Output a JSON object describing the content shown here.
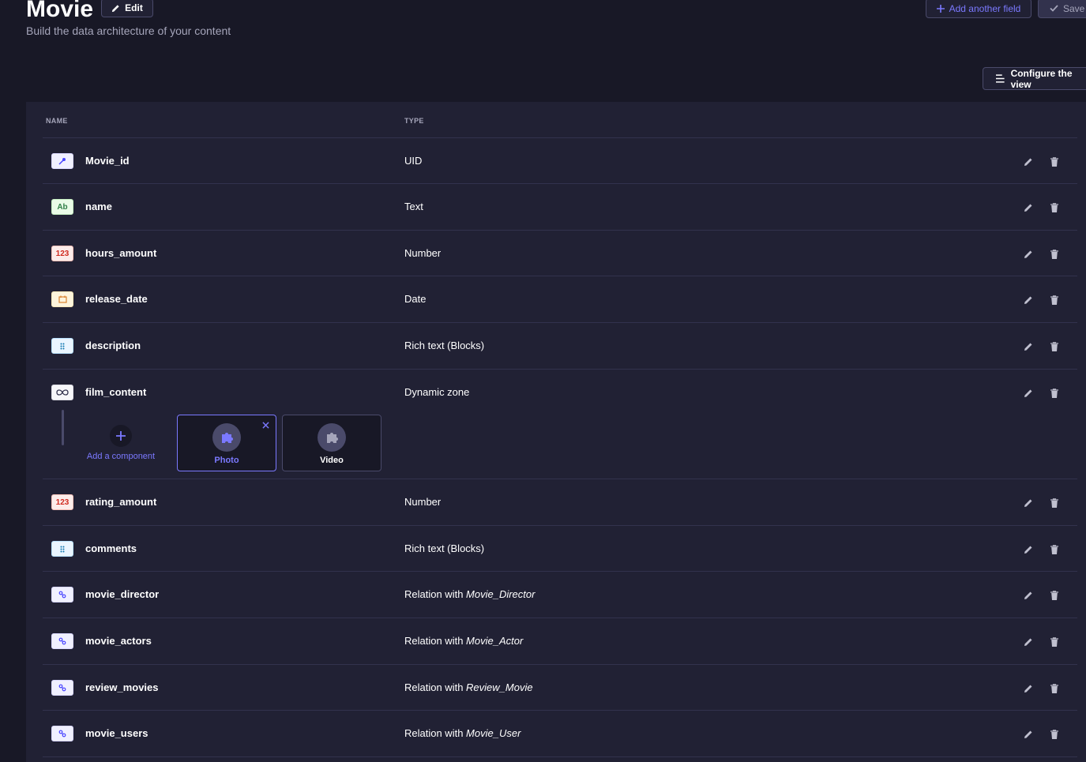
{
  "header": {
    "title": "Movie",
    "edit_label": "Edit",
    "subtitle": "Build the data architecture of your content",
    "add_field_label": "Add another field",
    "save_label": "Save",
    "configure_label": "Configure the view"
  },
  "table": {
    "col_name": "NAME",
    "col_type": "TYPE"
  },
  "fields": [
    {
      "name": "Movie_id",
      "type": "UID",
      "icon": "uid-icon",
      "icon_text": ""
    },
    {
      "name": "name",
      "type": "Text",
      "icon": "text-icon",
      "icon_text": "Ab"
    },
    {
      "name": "hours_amount",
      "type": "Number",
      "icon": "number-icon",
      "icon_text": "123"
    },
    {
      "name": "release_date",
      "type": "Date",
      "icon": "date-icon",
      "icon_text": ""
    },
    {
      "name": "description",
      "type": "Rich text (Blocks)",
      "icon": "blocks-icon",
      "icon_text": ""
    },
    {
      "name": "film_content",
      "type": "Dynamic zone",
      "icon": "dynamic-zone-icon",
      "icon_text": ""
    },
    {
      "name": "rating_amount",
      "type": "Number",
      "icon": "number-icon",
      "icon_text": "123"
    },
    {
      "name": "comments",
      "type": "Rich text (Blocks)",
      "icon": "blocks-icon",
      "icon_text": ""
    },
    {
      "name": "movie_director",
      "type_prefix": "Relation with ",
      "type_target": "Movie_Director",
      "icon": "relation-icon",
      "icon_text": ""
    },
    {
      "name": "movie_actors",
      "type_prefix": "Relation with ",
      "type_target": "Movie_Actor",
      "icon": "relation-icon",
      "icon_text": ""
    },
    {
      "name": "review_movies",
      "type_prefix": "Relation with ",
      "type_target": "Review_Movie",
      "icon": "relation-icon",
      "icon_text": ""
    },
    {
      "name": "movie_users",
      "type_prefix": "Relation with ",
      "type_target": "Movie_User",
      "icon": "relation-icon",
      "icon_text": ""
    }
  ],
  "dynamic_zone": {
    "add_component_label": "Add a component",
    "components": [
      {
        "label": "Photo",
        "active": true
      },
      {
        "label": "Video",
        "active": false
      }
    ]
  },
  "colors": {
    "accent": "#7b79ff",
    "background": "#181826",
    "panel": "#212134"
  }
}
